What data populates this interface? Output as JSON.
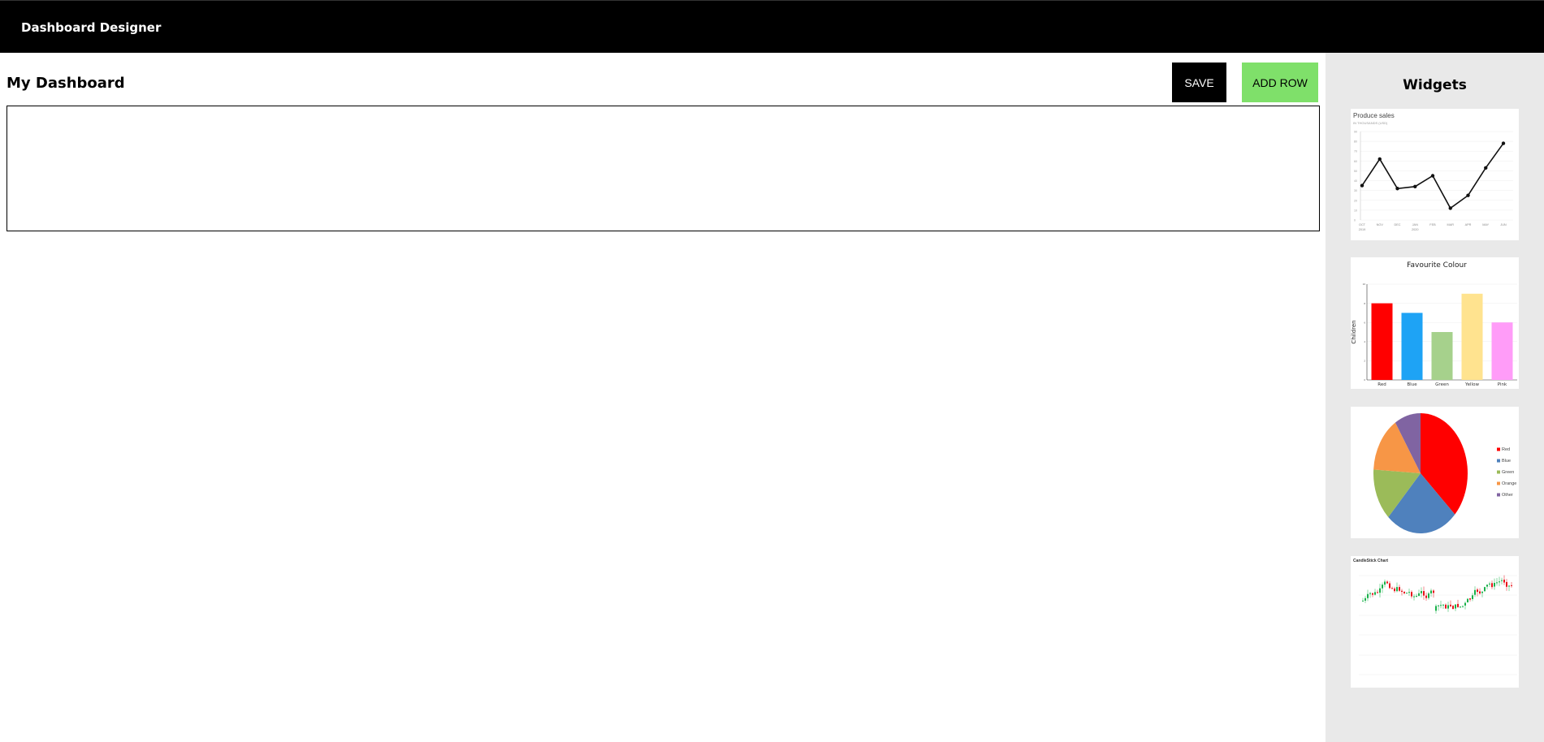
{
  "header": {
    "title": "Dashboard Designer"
  },
  "main": {
    "title": "My Dashboard",
    "save_label": "SAVE",
    "add_row_label": "ADD ROW"
  },
  "sidebar": {
    "title": "Widgets",
    "widgets": [
      {
        "name": "line-chart-widget",
        "chart_data": {
          "type": "line",
          "title": "Produce sales",
          "subtitle": "IN THOUSANDS (USD)",
          "categories": [
            "OCT 2019",
            "NOV",
            "DEC",
            "JAN 2020",
            "FEB",
            "MAR",
            "APR",
            "MAY",
            "JUN"
          ],
          "values": [
            35,
            62,
            32,
            34,
            45,
            12,
            25,
            53,
            78
          ],
          "ylim": [
            0,
            90
          ]
        }
      },
      {
        "name": "bar-chart-widget",
        "chart_data": {
          "type": "bar",
          "title": "Favourite Colour",
          "ylabel": "Children",
          "categories": [
            "Red",
            "Blue",
            "Green",
            "Yellow",
            "Pink"
          ],
          "values": [
            8,
            7,
            5,
            9,
            6
          ],
          "colors": [
            "#ff0000",
            "#1ea3f5",
            "#a6d18c",
            "#ffe38f",
            "#ff9cf8"
          ],
          "ylim": [
            0,
            10
          ]
        }
      },
      {
        "name": "pie-chart-widget",
        "chart_data": {
          "type": "pie",
          "categories": [
            "Red",
            "Blue",
            "Green",
            "Orange",
            "Other"
          ],
          "values": [
            37,
            25,
            14,
            15,
            9
          ],
          "colors": [
            "#ff0000",
            "#4f81bd",
            "#9bbb59",
            "#f79646",
            "#8064a2"
          ]
        }
      },
      {
        "name": "candlestick-chart-widget",
        "chart_data": {
          "type": "candlestick",
          "title": "CandleStick Chart"
        }
      }
    ]
  }
}
